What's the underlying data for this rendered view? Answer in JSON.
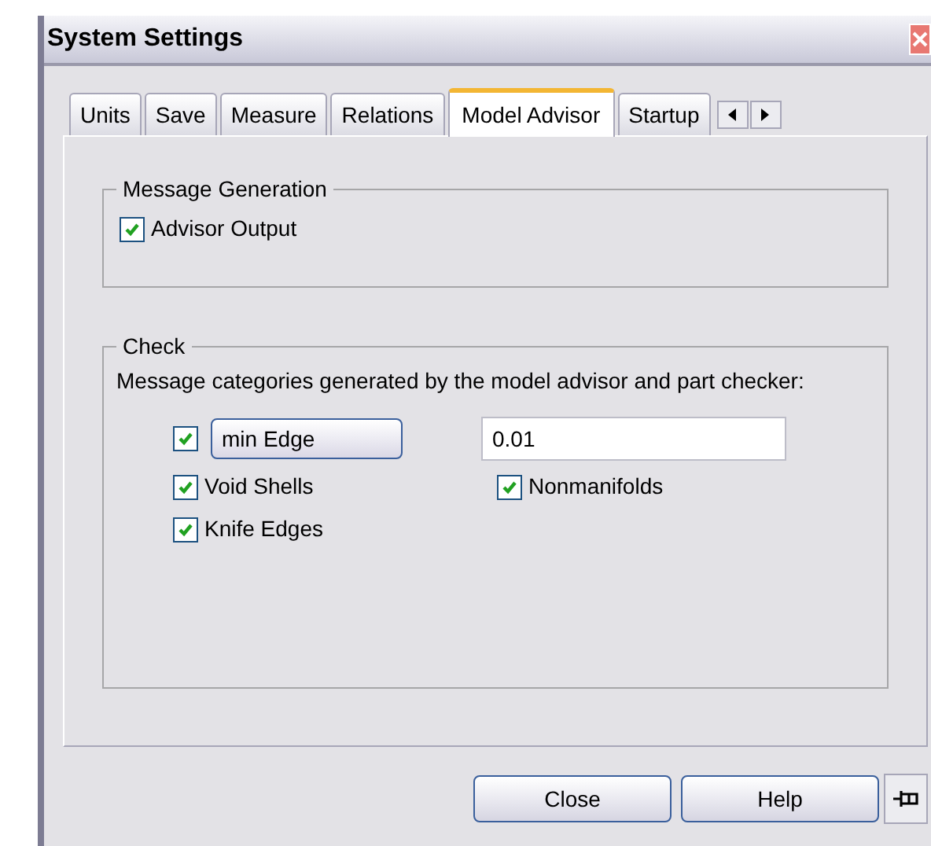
{
  "window": {
    "title": "System Settings"
  },
  "tabs": [
    {
      "label": "Units",
      "selected": false
    },
    {
      "label": "Save",
      "selected": false
    },
    {
      "label": "Measure",
      "selected": false
    },
    {
      "label": "Relations",
      "selected": false
    },
    {
      "label": "Model Advisor",
      "selected": true
    },
    {
      "label": "Startup",
      "selected": false
    }
  ],
  "message_generation": {
    "title": "Message Generation",
    "advisor_output": {
      "label": "Advisor Output",
      "checked": true
    }
  },
  "check": {
    "title": "Check",
    "description": "Message categories generated by the model advisor and part checker:",
    "min_edge": {
      "checked": true,
      "button": "min Edge",
      "value": "0.01"
    },
    "void_shells": {
      "label": "Void Shells",
      "checked": true
    },
    "nonmanifolds": {
      "label": "Nonmanifolds",
      "checked": true
    },
    "knife_edges": {
      "label": "Knife Edges",
      "checked": true
    }
  },
  "buttons": [
    "Close",
    "Help"
  ]
}
